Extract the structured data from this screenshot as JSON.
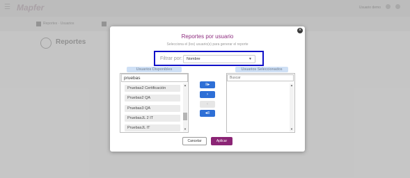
{
  "app": {
    "logo_text": "Mapfer",
    "user_label": "Usuario demo",
    "subbar_text": "Reportes · Usuarios",
    "page_title": "Reportes"
  },
  "modal": {
    "title": "Reportes por usuario",
    "subtitle": "Selecciona el (los) usuario(s) para generar el reporte",
    "filter_label": "Filtrar por:",
    "filter_value": "Nombre",
    "available_header": "Usuarios Disponibles",
    "selected_header": "Usuarios Seleccionados",
    "available_search": "pruebas",
    "selected_search_placeholder": "Buscar",
    "available_items": [
      "Pruebas2 Certificación",
      "Pruebas2 QA",
      "Pruebas3 QA",
      "PruebasJL 2 IT",
      "PruebasJL IT"
    ],
    "controls": {
      "move_all_right": "≡▸",
      "move_right": "›",
      "move_left": "‹",
      "move_all_left": "◂≡"
    },
    "cancel_label": "Cancelar",
    "apply_label": "Aplicar",
    "close_icon": "×"
  },
  "colors": {
    "accent": "#8b2575",
    "title": "#8e2d7f",
    "highlight": "#1010c8",
    "control_button": "#2e6fd6"
  }
}
